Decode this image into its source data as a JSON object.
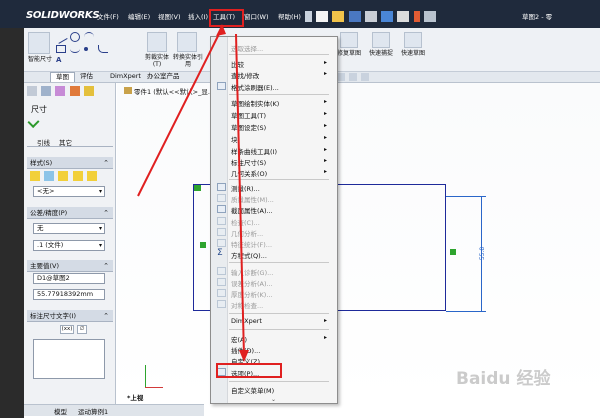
{
  "app": {
    "brand": "SOLIDWORKS",
    "title_right": "草图2 - 零"
  },
  "menubar": {
    "items": [
      {
        "label": "文件(F)"
      },
      {
        "label": "编辑(E)"
      },
      {
        "label": "视图(V)"
      },
      {
        "label": "插入(I)"
      },
      {
        "label": "工具(T)"
      },
      {
        "label": "窗口(W)"
      },
      {
        "label": "帮助(H)"
      }
    ]
  },
  "ribbon": {
    "left_labels": [
      "智能尺寸",
      "剪裁实体(T)",
      "转换实体引用"
    ],
    "right_labels": [
      "修复草图",
      "快速捕捉",
      "快速草图"
    ]
  },
  "command_tabs": [
    "草图",
    "评估",
    "DimXpert",
    "办公室产品"
  ],
  "tree": {
    "root": "零件1 (默认<<默认>_显..."
  },
  "property_manager": {
    "title": "尺寸",
    "tabs": [
      "引线",
      "其它"
    ],
    "sections": [
      {
        "label": "样式(S)"
      },
      {
        "label": "公差/精度(P)"
      },
      {
        "label": "主要值(V)"
      },
      {
        "label": "标注尺寸文字(I)"
      }
    ],
    "style_value": "<无>",
    "tolerance_value": "无",
    "precision_value": ".1 (文件)",
    "primary_name": "D1@草图2",
    "primary_value": "55.77918392mm",
    "dim_text_buttons": [
      "(xx)",
      "∅"
    ]
  },
  "tools_menu": {
    "items": [
      {
        "label": "选取选择...",
        "disabled": true,
        "submenu": false
      },
      {
        "label": "比较",
        "disabled": false,
        "submenu": true
      },
      {
        "label": "查找/修改",
        "disabled": false,
        "submenu": true
      },
      {
        "label": "格式涂刷器(E)...",
        "disabled": false,
        "submenu": false
      },
      {
        "label": "草图绘制实体(K)",
        "disabled": false,
        "submenu": true
      },
      {
        "label": "草图工具(T)",
        "disabled": false,
        "submenu": true
      },
      {
        "label": "草图设定(S)",
        "disabled": false,
        "submenu": true
      },
      {
        "label": "块",
        "disabled": false,
        "submenu": true
      },
      {
        "label": "样条曲线工具(I)",
        "disabled": false,
        "submenu": true
      },
      {
        "label": "标注尺寸(S)",
        "disabled": false,
        "submenu": true
      },
      {
        "label": "几何关系(O)",
        "disabled": false,
        "submenu": true
      },
      {
        "label": "测量(R)...",
        "disabled": false,
        "submenu": false
      },
      {
        "label": "质量属性(M)...",
        "disabled": true,
        "submenu": false
      },
      {
        "label": "截面属性(A)...",
        "disabled": false,
        "submenu": false
      },
      {
        "label": "检查(C)...",
        "disabled": true,
        "submenu": false
      },
      {
        "label": "几何分析...",
        "disabled": true,
        "submenu": false
      },
      {
        "label": "特征统计(F)...",
        "disabled": true,
        "submenu": false
      },
      {
        "label": "方程式(Q)...",
        "disabled": false,
        "submenu": false
      },
      {
        "label": "输入诊断(G)...",
        "disabled": true,
        "submenu": false
      },
      {
        "label": "误差分析(A)...",
        "disabled": true,
        "submenu": false
      },
      {
        "label": "厚度分析(K)...",
        "disabled": true,
        "submenu": false
      },
      {
        "label": "对称检查...",
        "disabled": true,
        "submenu": false
      },
      {
        "label": "DimXpert",
        "disabled": false,
        "submenu": true
      },
      {
        "label": "宏(A)",
        "disabled": false,
        "submenu": true
      },
      {
        "label": "插件(D)...",
        "disabled": false,
        "submenu": false
      },
      {
        "label": "自定义(Z)...",
        "disabled": false,
        "submenu": false
      },
      {
        "label": "选项(P)...",
        "disabled": false,
        "submenu": false
      },
      {
        "label": "自定义菜单(M)",
        "disabled": false,
        "submenu": false
      }
    ]
  },
  "canvas": {
    "dimension_value": "55.8",
    "view_label": "*上视"
  },
  "bottom_tabs": [
    "模型",
    "运动算例1"
  ],
  "watermark": "Baidu 经验",
  "colors": {
    "highlight_red": "#e02020",
    "sketch_blue": "#1e2a9a",
    "dimension_blue": "#2a66c9",
    "menubar_bg": "#1f2a3c"
  }
}
